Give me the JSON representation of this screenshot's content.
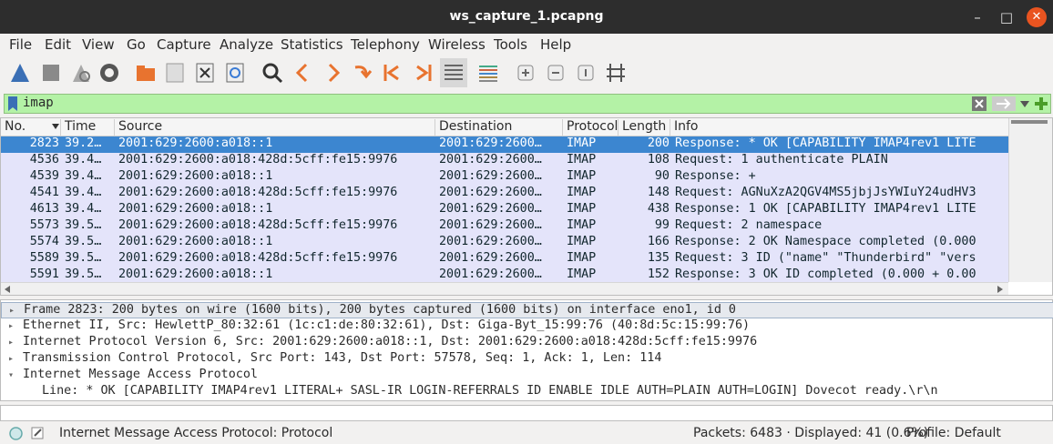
{
  "window": {
    "title": "ws_capture_1.pcapng"
  },
  "menu": [
    "File",
    "Edit",
    "View",
    "Go",
    "Capture",
    "Analyze",
    "Statistics",
    "Telephony",
    "Wireless",
    "Tools",
    "Help"
  ],
  "toolbar_icons": [
    "shark-fin-start-icon",
    "stop-capture-icon",
    "restart-capture-icon",
    "capture-options-icon",
    "open-file-icon",
    "save-file-icon",
    "close-file-icon",
    "reload-file-icon",
    "find-packet-icon",
    "go-back-icon",
    "go-forward-icon",
    "go-to-packet-icon",
    "first-packet-icon",
    "last-packet-icon",
    "auto-scroll-icon",
    "colorize-icon",
    "zoom-in-icon",
    "zoom-out-icon",
    "normal-size-icon",
    "resize-columns-icon"
  ],
  "filter": {
    "value": "imap"
  },
  "columns": [
    "No.",
    "Time",
    "Source",
    "Destination",
    "Protocol",
    "Length",
    "Info"
  ],
  "packets": [
    {
      "no": "2823",
      "time": "39.2…",
      "src": "2001:629:2600:a018::1",
      "dst": "2001:629:2600…",
      "proto": "IMAP",
      "len": "200",
      "info": "Response: * OK [CAPABILITY IMAP4rev1 LITE"
    },
    {
      "no": "4536",
      "time": "39.4…",
      "src": "2001:629:2600:a018:428d:5cff:fe15:9976",
      "dst": "2001:629:2600…",
      "proto": "IMAP",
      "len": "108",
      "info": "Request: 1 authenticate PLAIN"
    },
    {
      "no": "4539",
      "time": "39.4…",
      "src": "2001:629:2600:a018::1",
      "dst": "2001:629:2600…",
      "proto": "IMAP",
      "len": "90",
      "info": "Response: +"
    },
    {
      "no": "4541",
      "time": "39.4…",
      "src": "2001:629:2600:a018:428d:5cff:fe15:9976",
      "dst": "2001:629:2600…",
      "proto": "IMAP",
      "len": "148",
      "info": "Request: AGNuXzA2QGV4MS5jbjJsYWIuY24udHV3"
    },
    {
      "no": "4613",
      "time": "39.4…",
      "src": "2001:629:2600:a018::1",
      "dst": "2001:629:2600…",
      "proto": "IMAP",
      "len": "438",
      "info": "Response: 1 OK [CAPABILITY IMAP4rev1 LITE"
    },
    {
      "no": "5573",
      "time": "39.5…",
      "src": "2001:629:2600:a018:428d:5cff:fe15:9976",
      "dst": "2001:629:2600…",
      "proto": "IMAP",
      "len": "99",
      "info": "Request: 2 namespace"
    },
    {
      "no": "5574",
      "time": "39.5…",
      "src": "2001:629:2600:a018::1",
      "dst": "2001:629:2600…",
      "proto": "IMAP",
      "len": "166",
      "info": "Response: 2 OK Namespace completed (0.000"
    },
    {
      "no": "5589",
      "time": "39.5…",
      "src": "2001:629:2600:a018:428d:5cff:fe15:9976",
      "dst": "2001:629:2600…",
      "proto": "IMAP",
      "len": "135",
      "info": "Request: 3 ID (\"name\" \"Thunderbird\" \"vers"
    },
    {
      "no": "5591",
      "time": "39.5…",
      "src": "2001:629:2600:a018::1",
      "dst": "2001:629:2600…",
      "proto": "IMAP",
      "len": "152",
      "info": "Response: 3 OK ID completed (0.000 + 0.00"
    }
  ],
  "details": [
    {
      "arrow": "▸",
      "text": "Frame 2823: 200 bytes on wire (1600 bits), 200 bytes captured (1600 bits) on interface eno1, id 0"
    },
    {
      "arrow": "▸",
      "text": "Ethernet II, Src: HewlettP_80:32:61 (1c:c1:de:80:32:61), Dst: Giga-Byt_15:99:76 (40:8d:5c:15:99:76)"
    },
    {
      "arrow": "▸",
      "text": "Internet Protocol Version 6, Src: 2001:629:2600:a018::1, Dst: 2001:629:2600:a018:428d:5cff:fe15:9976"
    },
    {
      "arrow": "▸",
      "text": "Transmission Control Protocol, Src Port: 143, Dst Port: 57578, Seq: 1, Ack: 1, Len: 114"
    },
    {
      "arrow": "▾",
      "text": "Internet Message Access Protocol"
    },
    {
      "arrow": "",
      "text": "Line: * OK [CAPABILITY IMAP4rev1 LITERAL+ SASL-IR LOGIN-REFERRALS ID ENABLE IDLE AUTH=PLAIN AUTH=LOGIN] Dovecot ready.\\r\\n"
    }
  ],
  "status": {
    "field": "Internet Message Access Protocol: Protocol",
    "packets": "Packets: 6483 · Displayed: 41 (0.6%)",
    "profile": "Profile: Default"
  }
}
